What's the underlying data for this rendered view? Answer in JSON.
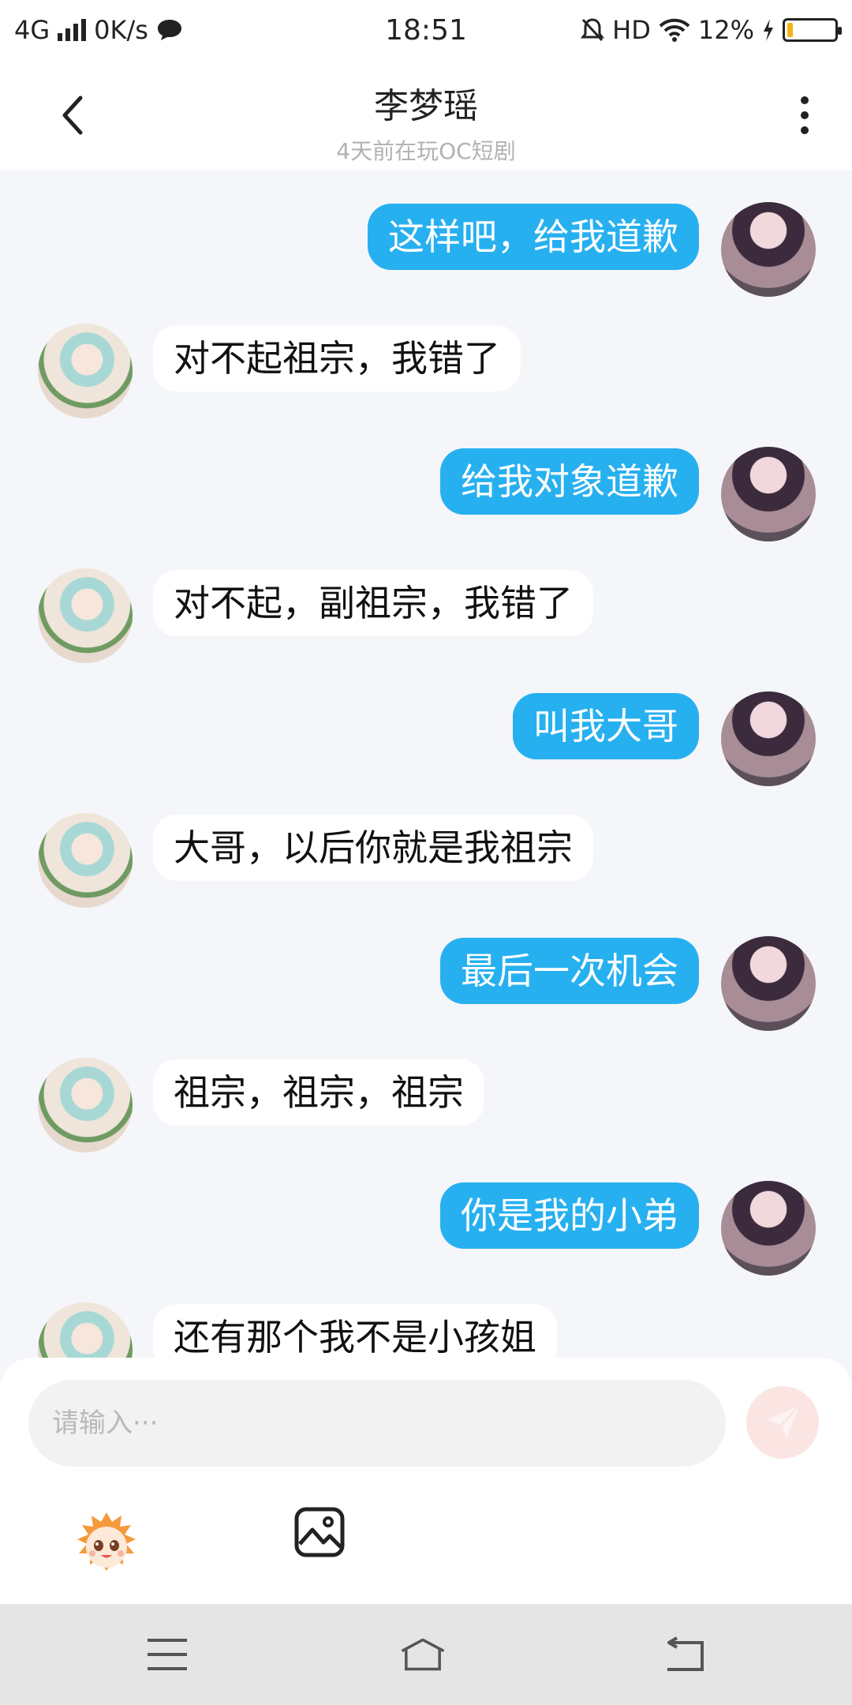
{
  "status_bar": {
    "network": "4G",
    "speed": "0K/s",
    "time": "18:51",
    "hd": "HD",
    "battery_pct": "12%",
    "battery_level": 0.12
  },
  "header": {
    "title": "李梦瑶",
    "subtitle": "4天前在玩OC短剧"
  },
  "messages": [
    {
      "sender": "me",
      "text": "这样吧，给我道歉"
    },
    {
      "sender": "them",
      "text": "对不起祖宗，我错了"
    },
    {
      "sender": "me",
      "text": "给我对象道歉"
    },
    {
      "sender": "them",
      "text": "对不起，副祖宗，我错了"
    },
    {
      "sender": "me",
      "text": "叫我大哥"
    },
    {
      "sender": "them",
      "text": "大哥，以后你就是我祖宗"
    },
    {
      "sender": "me",
      "text": "最后一次机会"
    },
    {
      "sender": "them",
      "text": "祖宗，祖宗，祖宗"
    },
    {
      "sender": "me",
      "text": "你是我的小弟"
    },
    {
      "sender": "them",
      "text": "还有那个我不是小孩姐"
    }
  ],
  "composer": {
    "placeholder": "请输入···"
  },
  "colors": {
    "accent": "#27b0f0",
    "battery": "#f3b417",
    "send_button": "#fbe5e3"
  },
  "icons": [
    "back-icon",
    "more-icon",
    "message-icon",
    "mute-icon",
    "wifi-icon",
    "charging-icon",
    "send-icon",
    "emoji-icon",
    "image-icon",
    "menu-icon",
    "home-icon",
    "back-nav-icon"
  ]
}
